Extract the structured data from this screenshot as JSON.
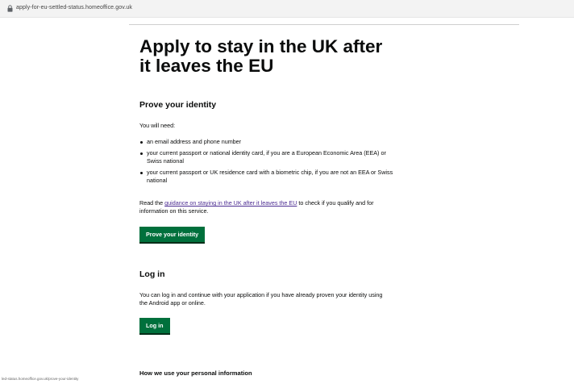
{
  "browser": {
    "url": "apply-for-eu-settled-status.homeoffice.gov.uk",
    "status_url": "led-status.homeoffice.gov.uk/prove-your-identity"
  },
  "page": {
    "title": "Apply to stay in the UK after it leaves the EU"
  },
  "prove_identity": {
    "heading": "Prove your identity",
    "intro": "You will need:",
    "items": [
      "an email address and phone number",
      "your current passport or national identity card, if you are a European Economic Area (EEA) or Swiss national",
      "your current passport or UK residence card with a biometric chip, if you are not an EEA or Swiss national"
    ],
    "read_prefix": "Read the ",
    "guidance_link": "guidance on staying in the UK after it leaves the EU",
    "read_suffix": " to check if you qualify and for information on this service.",
    "button": "Prove your identity"
  },
  "log_in": {
    "heading": "Log in",
    "text": "You can log in and continue with your application if you have already proven your identity using the Android app or online.",
    "button": "Log in"
  },
  "personal_info": {
    "heading": "How we use your personal information"
  },
  "colors": {
    "button_green": "#00703c",
    "link_visited": "#4c2c92",
    "text": "#0b0c0c"
  }
}
